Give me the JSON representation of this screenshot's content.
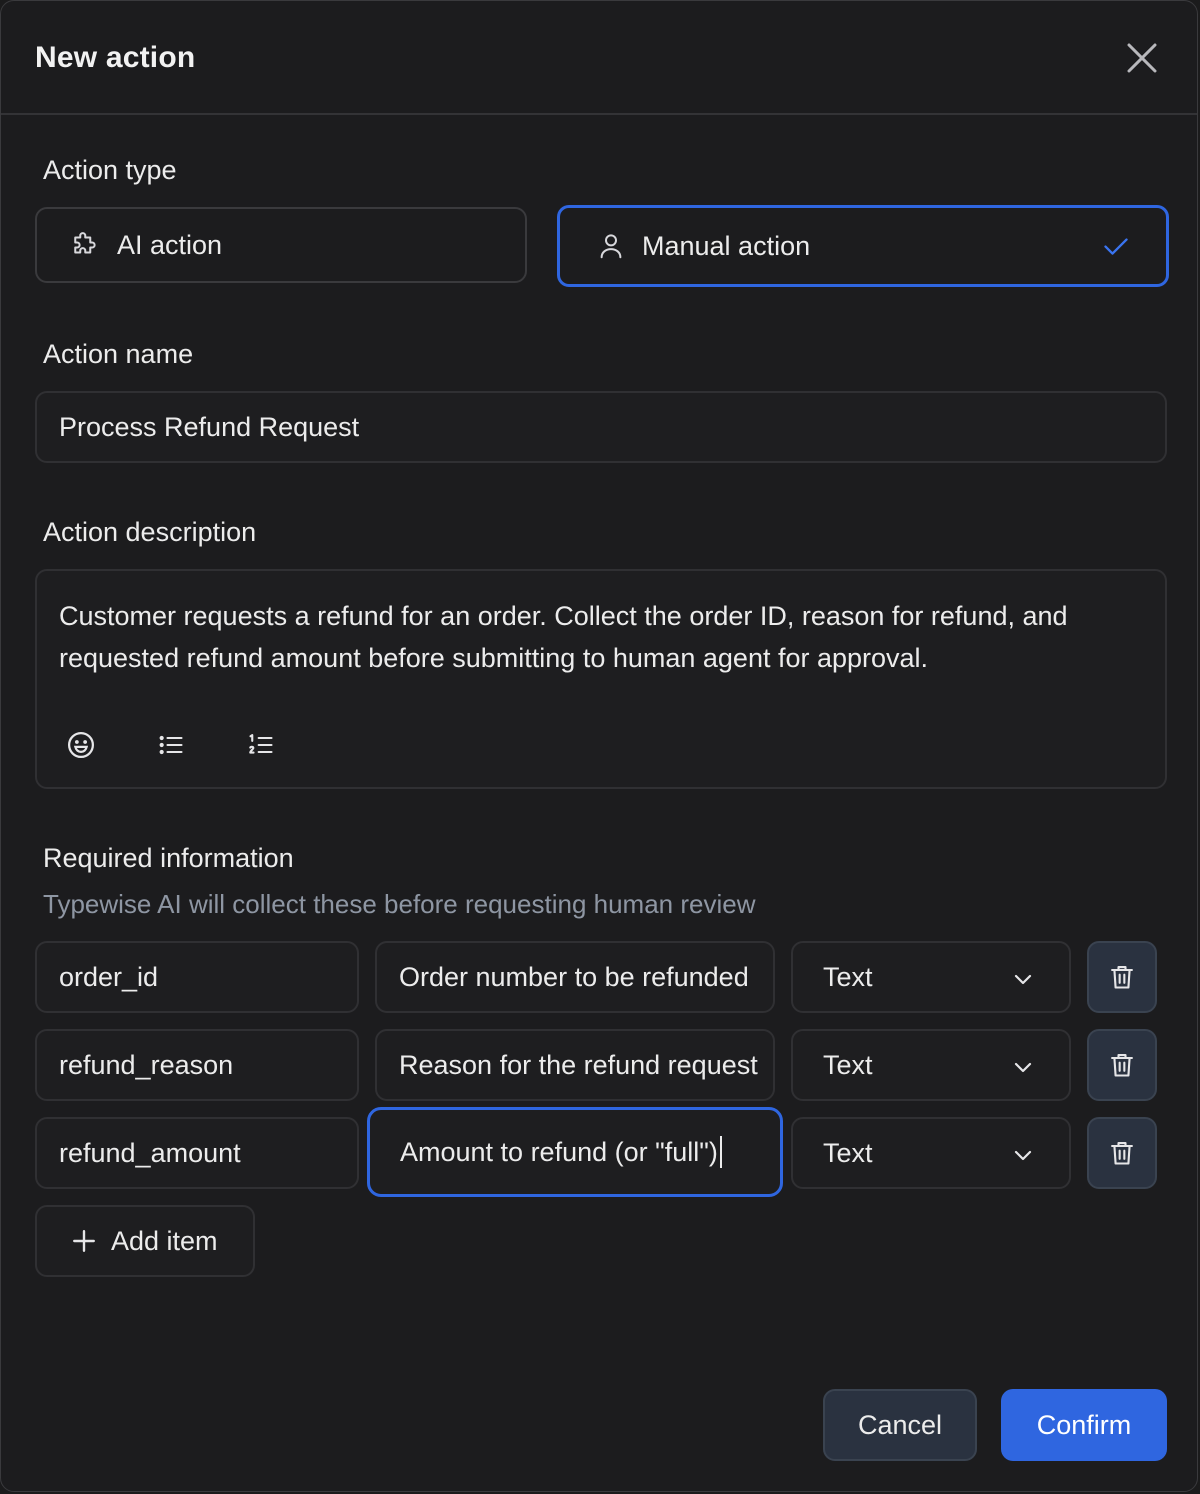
{
  "dialog": {
    "title": "New action",
    "close_icon": "close-icon"
  },
  "action_type": {
    "label": "Action type",
    "options": [
      {
        "label": "AI action",
        "icon": "puzzle-icon",
        "selected": false
      },
      {
        "label": "Manual action",
        "icon": "user-icon",
        "selected": true
      }
    ],
    "accent_color": "#2f66e0"
  },
  "action_name": {
    "label": "Action name",
    "value": "Process Refund Request"
  },
  "action_description": {
    "label": "Action description",
    "value": "Customer requests a refund for an order. Collect the order ID, reason for refund, and requested refund amount before submitting to human agent for approval.",
    "toolbar": [
      "emoji-icon",
      "bullet-list-icon",
      "numbered-list-icon"
    ]
  },
  "required_information": {
    "label": "Required information",
    "hint": "Typewise AI will collect these before requesting human review",
    "items": [
      {
        "name": "order_id",
        "description": "Order number to be refunded",
        "type": "Text"
      },
      {
        "name": "refund_reason",
        "description": "Reason for the refund request",
        "type": "Text"
      },
      {
        "name": "refund_amount",
        "description": "Amount to refund (or \"full\")",
        "type": "Text"
      }
    ],
    "add_label": "Add item"
  },
  "footer": {
    "cancel_label": "Cancel",
    "confirm_label": "Confirm"
  }
}
